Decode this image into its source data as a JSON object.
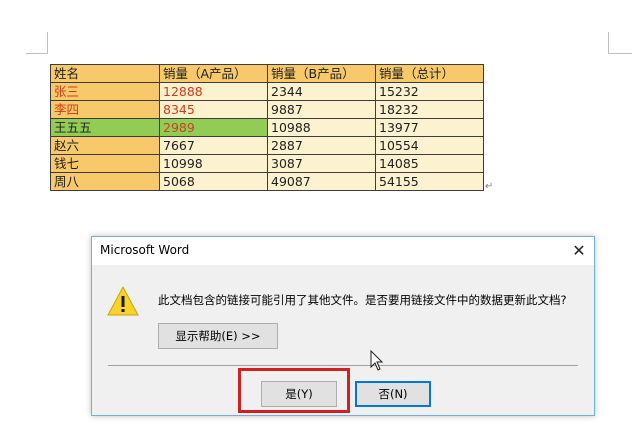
{
  "table": {
    "headers": [
      "姓名",
      "销量（A产品）",
      "销量（B产品）",
      "销量（总计）"
    ],
    "rows": [
      [
        "张三",
        "12888",
        "2344",
        "15232"
      ],
      [
        "李四",
        "8345",
        "9887",
        "18232"
      ],
      [
        "王五五",
        "2989",
        "10988",
        "13977"
      ],
      [
        "赵六",
        "7667",
        "2887",
        "10554"
      ],
      [
        "钱七",
        "10998",
        "3087",
        "14085"
      ],
      [
        "周八",
        "5068",
        "49087",
        "54155"
      ]
    ],
    "paragraph_mark": "↵"
  },
  "dialog": {
    "title": "Microsoft Word",
    "close_symbol": "✕",
    "message": "此文档包含的链接可能引用了其他文件。是否要用链接文件中的数据更新此文档?",
    "help_label": "显示帮助(E) >>",
    "yes_label": "是(Y)",
    "no_label": "否(N)"
  },
  "icons": {
    "warning": "warning-icon",
    "cursor": "mouse-pointer-icon"
  },
  "colors": {
    "header_fill": "#f7c96a",
    "cell_fill": "#fdf2d0",
    "highlight_green": "#92cc54",
    "red_text": "#d03a1c",
    "highlight_box": "#d02020",
    "default_button_border": "#0078d7"
  }
}
